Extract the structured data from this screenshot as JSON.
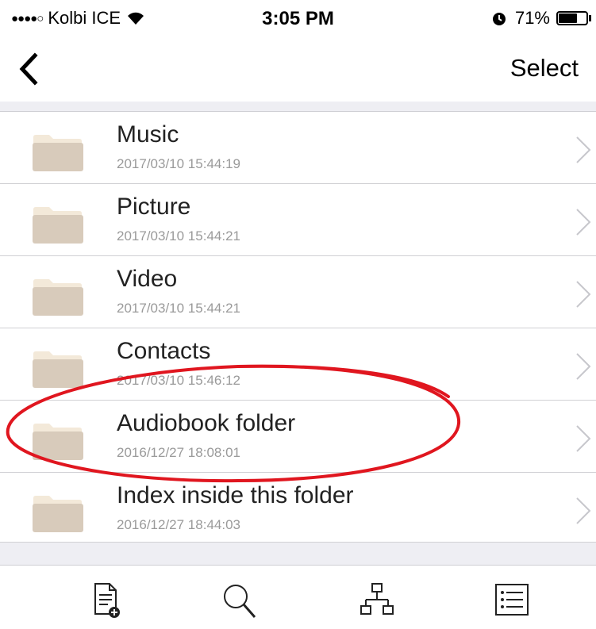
{
  "status_bar": {
    "signal_dots": "●●●●○",
    "carrier": "Kolbi ICE",
    "time": "3:05 PM",
    "battery_percent": "71%",
    "battery_level": 0.71
  },
  "nav": {
    "select_label": "Select"
  },
  "files": [
    {
      "name": "Music",
      "date": "2017/03/10 15:44:19"
    },
    {
      "name": "Picture",
      "date": "2017/03/10 15:44:21"
    },
    {
      "name": "Video",
      "date": "2017/03/10 15:44:21"
    },
    {
      "name": "Contacts",
      "date": "2017/03/10 15:46:12"
    },
    {
      "name": "Audiobook folder",
      "date": "2016/12/27 18:08:01"
    },
    {
      "name": "Index inside this folder",
      "date": "2016/12/27 18:44:03"
    }
  ],
  "toolbar": {
    "icons": [
      "new-file-icon",
      "search-icon",
      "folder-tree-icon",
      "list-view-icon"
    ]
  },
  "colors": {
    "folder_front": "#d8cbbb",
    "folder_back": "#f3e9d9",
    "separator_bg": "#eeeef3",
    "annotation_red": "#e0161f",
    "date_gray": "#9a9a9a"
  }
}
